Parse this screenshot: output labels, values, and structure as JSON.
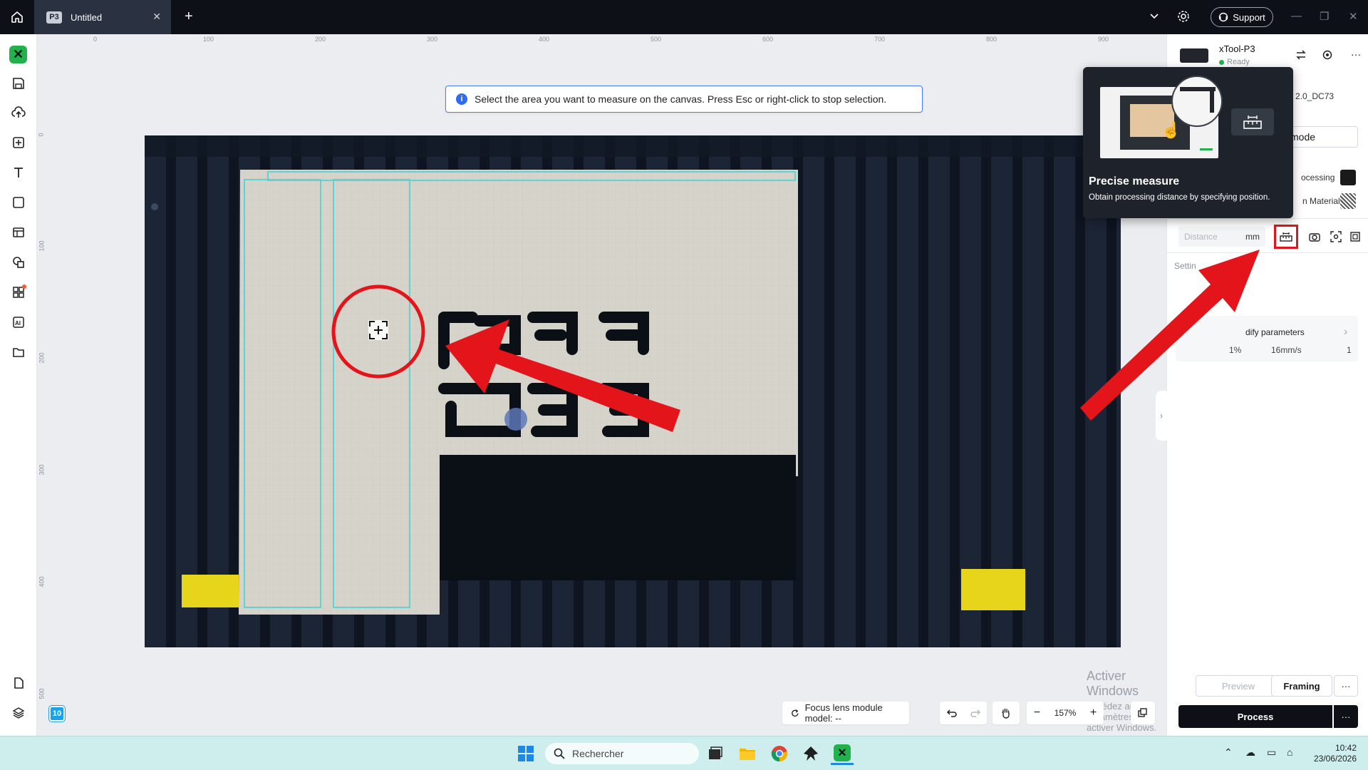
{
  "titlebar": {
    "tab_badge": "P3",
    "tab_title": "Untitled",
    "tab_close": "✕",
    "new_tab": "+",
    "support_label": "Support",
    "window_controls": [
      "—",
      "❐",
      "✕"
    ]
  },
  "left_toolbar": {
    "tools": [
      "save-icon",
      "upload-icon",
      "add-icon",
      "text-icon",
      "shape-icon",
      "layout-icon",
      "shapes-icon",
      "apps-icon",
      "ai-text-icon",
      "folder-icon",
      "document-icon",
      "layers-icon"
    ],
    "layers_count": "10"
  },
  "rulers": {
    "top": [
      "0",
      "100",
      "200",
      "300",
      "400",
      "500",
      "600",
      "700",
      "800",
      "900"
    ],
    "left": [
      "0",
      "100",
      "200",
      "300",
      "400",
      "500"
    ]
  },
  "banner": {
    "text": "Select the area you want to measure on the canvas. Press Esc or right-click to stop selection."
  },
  "watermark": {
    "title": "Activer Windows",
    "subtitle": "Accédez aux paramètres pour activer Windows."
  },
  "bottom_bar": {
    "focus_text": "Focus lens module model: --",
    "zoom": "157%",
    "zoom_out": "−",
    "zoom_in": "+"
  },
  "right_panel": {
    "device_name": "xTool-P3",
    "status": "Ready",
    "firmware": "2.0_DC73",
    "mode_label": "mode",
    "processing_label": "ocessing",
    "material_label": "n Material",
    "distance_placeholder": "Distance",
    "distance_unit": "mm",
    "settings_label": "Settin",
    "params_label": "dify parameters",
    "param_power": "1%",
    "param_speed": "16mm/s",
    "param_passes": "1",
    "preview_label": "Preview",
    "framing_label": "Framing",
    "more_label": "···",
    "process_label": "Process"
  },
  "tooltip": {
    "title": "Precise measure",
    "description": "Obtain processing distance by specifying position."
  },
  "taskbar": {
    "search_placeholder": "Rechercher",
    "time": "10:42",
    "date": "23/06/2026"
  },
  "colors": {
    "accent": "#22b14c",
    "annotation_red": "#e4141b",
    "info_blue": "#2f6cf0",
    "selection_cyan": "#5fd3d3"
  }
}
